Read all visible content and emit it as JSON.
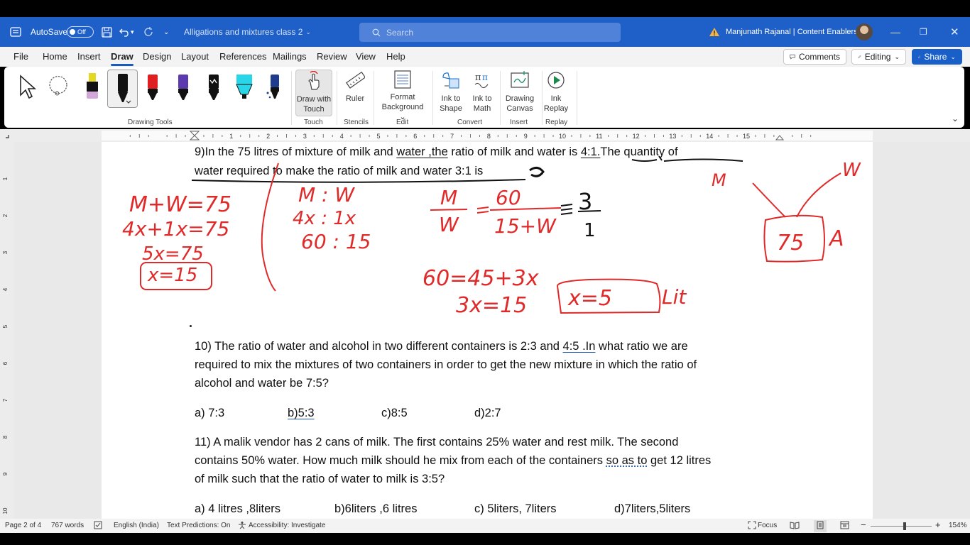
{
  "titlebar": {
    "autosave_label": "AutoSave",
    "autosave_state": "Off",
    "doc_title": "Alligations and mixtures class 2",
    "search_placeholder": "Search",
    "user_name": "Manjunath Rajanal | Content Enablers"
  },
  "menu": {
    "tabs": [
      "File",
      "Home",
      "Insert",
      "Draw",
      "Design",
      "Layout",
      "References",
      "Mailings",
      "Review",
      "View",
      "Help"
    ],
    "active_tab": "Draw",
    "comments_label": "Comments",
    "editing_label": "Editing",
    "share_label": "Share"
  },
  "ribbon": {
    "drawing_tools_label": "Drawing Tools",
    "touch": {
      "button": "Draw with Touch",
      "line1": "Draw with",
      "line2": "Touch",
      "group": "Touch"
    },
    "stencils": {
      "button": "Ruler",
      "group": "Stencils"
    },
    "edit": {
      "line1": "Format",
      "line2": "Background",
      "group": "Edit"
    },
    "convert": {
      "shape_line1": "Ink to",
      "shape_line2": "Shape",
      "math_line1": "Ink to",
      "math_line2": "Math",
      "group": "Convert"
    },
    "insert": {
      "line1": "Drawing",
      "line2": "Canvas",
      "group": "Insert"
    },
    "replay": {
      "line1": "Ink",
      "line2": "Replay",
      "group": "Replay"
    },
    "pen_colors": [
      "#e5d91f",
      "#111111",
      "#e02020",
      "#5b3ab0",
      "#111111",
      "#29d6e8",
      "#1f3c8c"
    ]
  },
  "ruler": {
    "numbers": [
      "1",
      "2",
      "3",
      "4",
      "5",
      "6",
      "7",
      "8",
      "9",
      "10",
      "11",
      "12",
      "13",
      "14",
      "15"
    ],
    "vnumbers": [
      "1",
      "2",
      "3",
      "4",
      "5",
      "6",
      "7",
      "8",
      "9",
      "10"
    ]
  },
  "document": {
    "q9_line1_a": "9)In the 75 litres of mixture of milk and ",
    "q9_line1_b": "water ,the",
    "q9_line1_c": " ratio of milk and water is ",
    "q9_line1_d": "4:1.",
    "q9_line1_e": "The quantity of",
    "q9_line2": "water required to make the ratio of milk and water 3:1 is",
    "q10_line1_a": "10) The ratio of water and alcohol in two different containers is 2:3 and ",
    "q10_line1_b": "4:5 .In",
    "q10_line1_c": " what ratio we are",
    "q10_line2": "required to mix the mixtures of two containers in order to get the new mixture in which the ratio of",
    "q10_line3": "alcohol and water be 7:5?",
    "q10_options": [
      "a) 7:3",
      "b)5:3",
      "c)8:5",
      "d)2:7"
    ],
    "q11_line1": "11) A malik vendor has 2 cans of milk. The first contains 25% water and rest milk. The second",
    "q11_line2_a": "contains 50% water. How much milk should he mix from each of the containers ",
    "q11_line2_b": "so as to",
    "q11_line2_c": " get 12 litres",
    "q11_line3": "of milk such that the ratio of water to milk is 3:5?",
    "q11_options": [
      "a) 4 litres ,8liters",
      "b)6liters ,6 litres",
      "c) 5liters, 7liters",
      "d)7liters,5liters"
    ]
  },
  "ink_notes": {
    "left1": "M+W=75",
    "left2": "4x+1x=75",
    "left3": "5x=75",
    "left4": "x=15",
    "mid1": "M : W",
    "mid2": "4x : 1x",
    "mid3": "60 : 15",
    "frac_m": "M",
    "frac_w": "W",
    "frac_num": "60",
    "frac_den": "15+W",
    "frac_r_num": "3",
    "frac_r_den": "1",
    "eq1": "60=45+3x",
    "eq2": "3x=15",
    "eq3": "x=5",
    "eq3_unit": "Lit",
    "tree_m": "M",
    "tree_w": "W",
    "tree_box": "75",
    "tree_a": "A"
  },
  "statusbar": {
    "page": "Page 2 of 4",
    "words": "767 words",
    "language": "English (India)",
    "predictions": "Text Predictions: On",
    "accessibility": "Accessibility: Investigate",
    "focus": "Focus",
    "zoom": "154%"
  },
  "colors": {
    "titlebar": "#1f5fc8",
    "ink_red": "#e02a2a",
    "accent": "#185abd"
  }
}
